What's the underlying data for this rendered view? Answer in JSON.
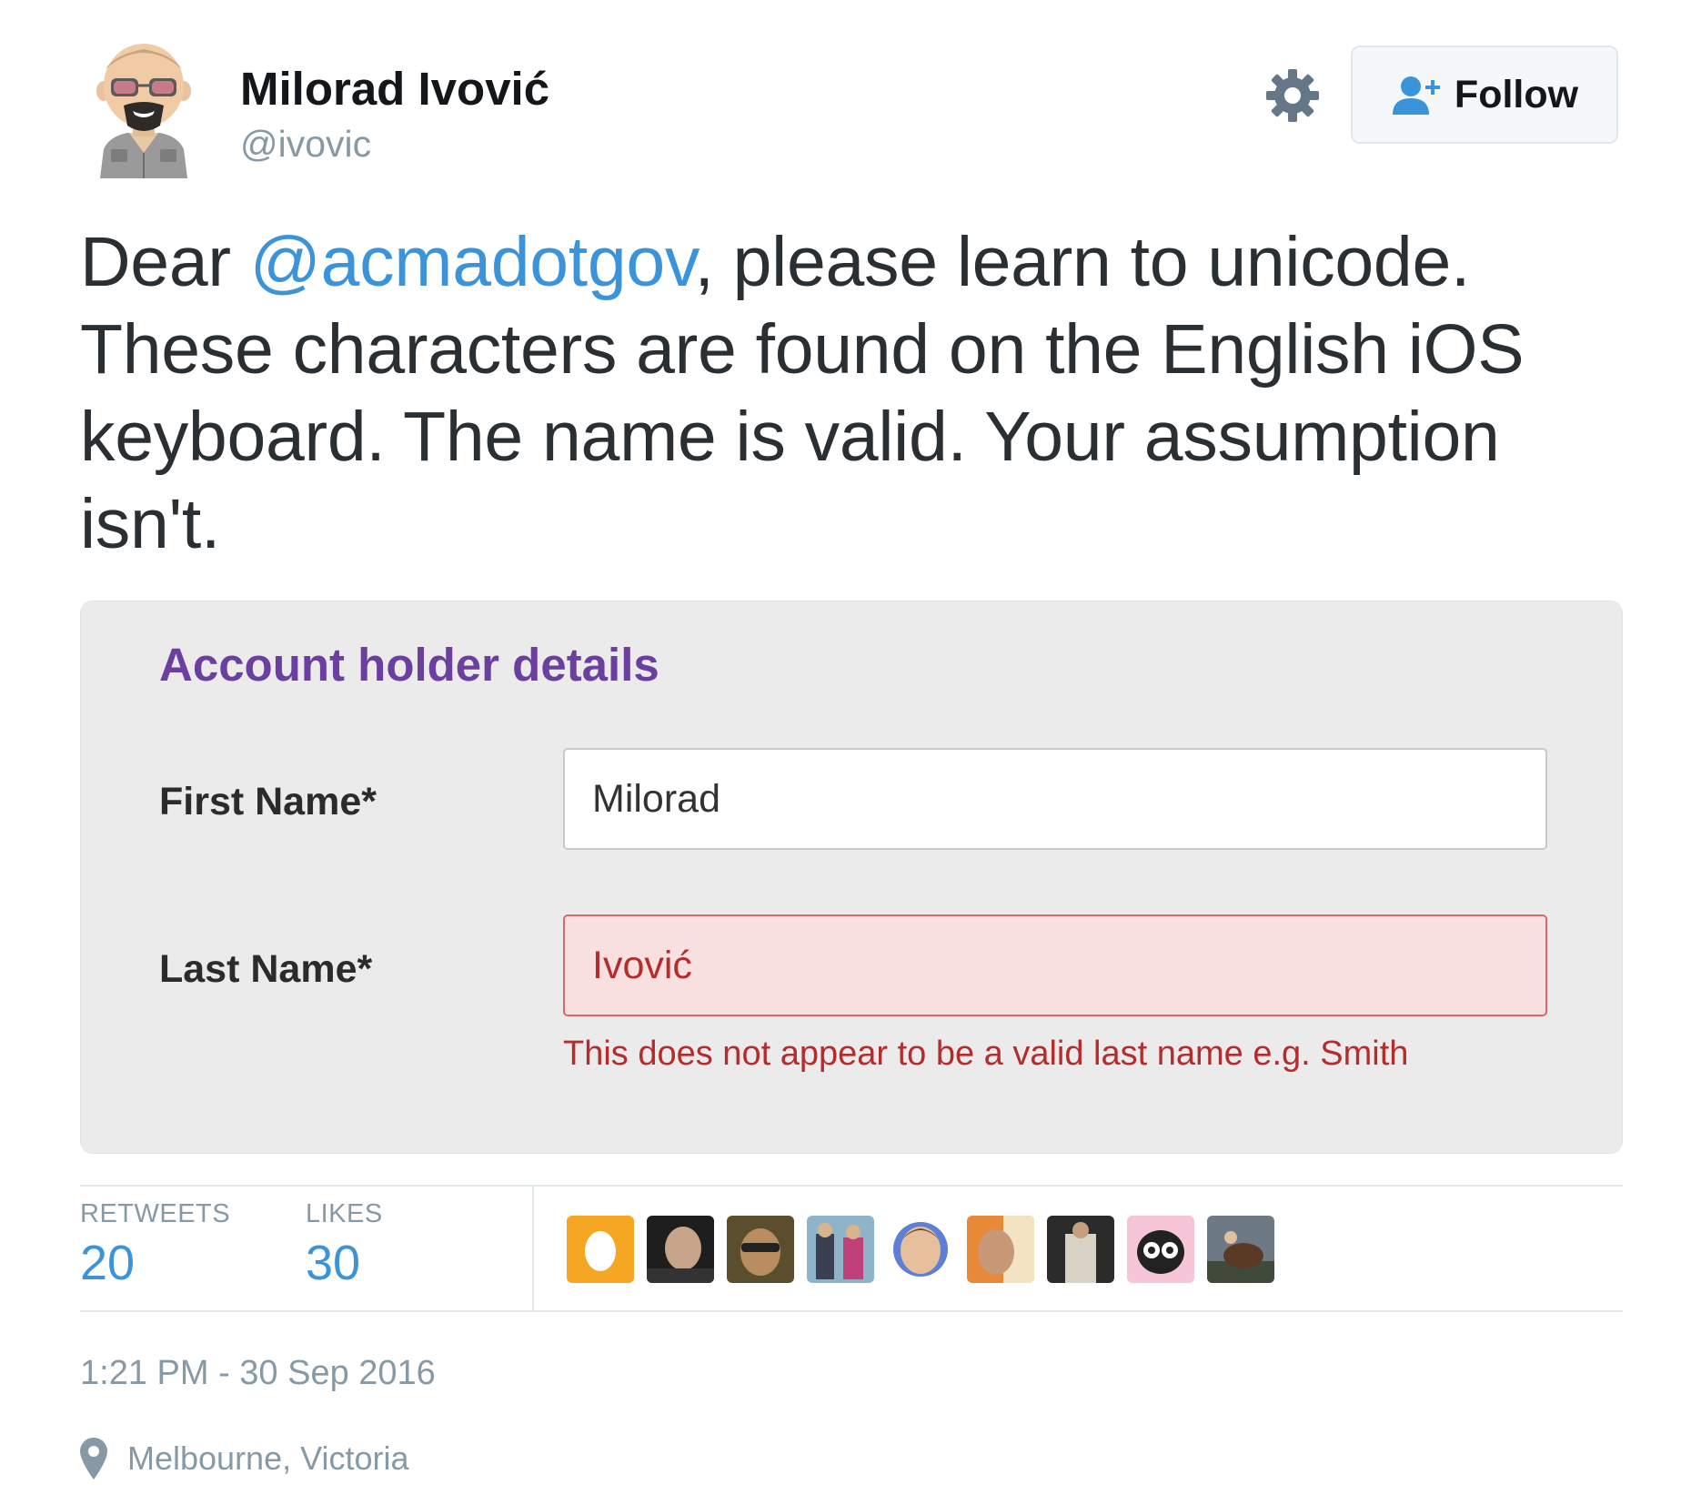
{
  "user": {
    "display_name": "Milorad Ivović",
    "handle": "@ivovic"
  },
  "actions": {
    "follow_label": "Follow",
    "settings_icon": "gear-icon",
    "follow_icon": "add-user-icon"
  },
  "tweet": {
    "text_before": "Dear ",
    "mention": "@acmadotgov",
    "text_after": ", please learn to unicode. These characters are found on the English iOS keyboard. The name is valid. Your assumption isn't."
  },
  "media": {
    "title": "Account holder details",
    "first_name_label": "First Name*",
    "first_name_value": "Milorad",
    "last_name_label": "Last Name*",
    "last_name_value": "Ivović",
    "error_message": "This does not appear to be a valid last name e.g. Smith"
  },
  "stats": {
    "retweets_label": "RETWEETS",
    "retweets_count": "20",
    "likes_label": "LIKES",
    "likes_count": "30"
  },
  "meta": {
    "timestamp": "1:21 PM - 30 Sep 2016",
    "location": "Melbourne, Victoria"
  },
  "colors": {
    "link_blue": "#3b94d9",
    "form_title_purple": "#6b3fa0",
    "error_red": "#b42c2c",
    "muted_gray": "#8899a6"
  }
}
